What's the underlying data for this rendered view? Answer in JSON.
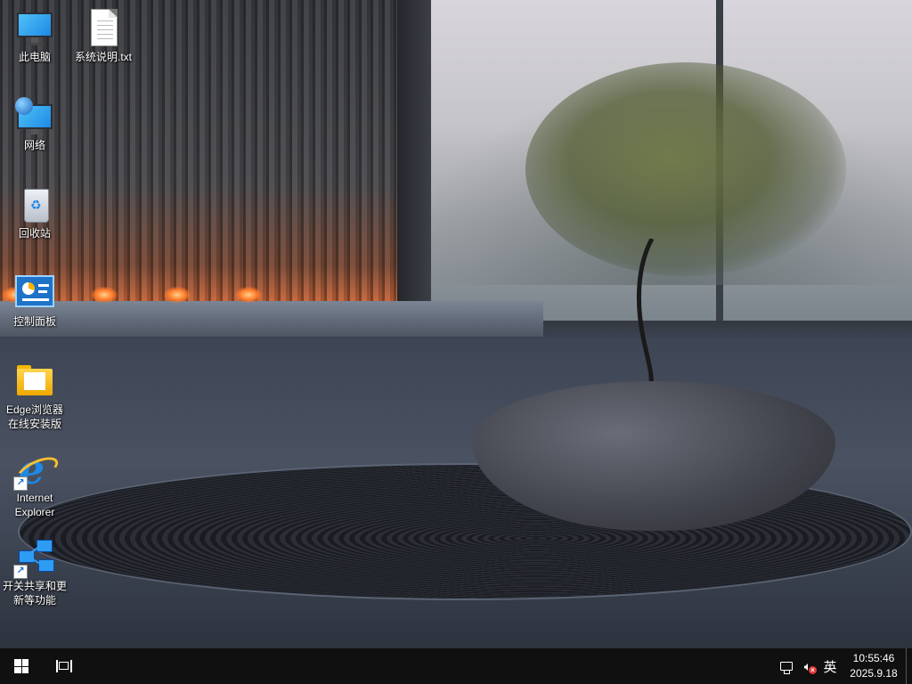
{
  "desktop": {
    "icons": [
      {
        "label": "此电脑",
        "icon": "monitor-icon"
      },
      {
        "label": "系统说明.txt",
        "icon": "text-file-icon"
      },
      {
        "label": "网络",
        "icon": "network-icon"
      },
      {
        "label": "回收站",
        "icon": "recycle-bin-icon"
      },
      {
        "label": "控制面板",
        "icon": "control-panel-icon"
      },
      {
        "label_line1": "Edge浏览器",
        "label_line2": "在线安装版",
        "icon": "folder-icon"
      },
      {
        "label_line1": "Internet",
        "label_line2": "Explorer",
        "icon": "internet-explorer-icon"
      },
      {
        "label_line1": "开关共享和更",
        "label_line2": "新等功能",
        "icon": "network-sharing-icon"
      }
    ]
  },
  "taskbar": {
    "start_icon": "windows-logo-icon",
    "task_view_icon": "task-view-icon",
    "tray": {
      "network_icon": "network-icon",
      "volume_icon": "volume-muted-icon",
      "ime_label": "英",
      "time": "10:55:46",
      "date": "2025.9.18"
    }
  },
  "colors": {
    "taskbar_bg": "#101010",
    "label_text": "#ffffff"
  }
}
